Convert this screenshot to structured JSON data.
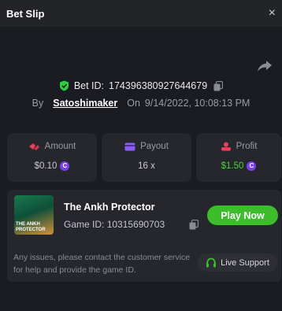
{
  "header": {
    "title": "Bet Slip",
    "close_glyph": "×"
  },
  "bet": {
    "id_label": "Bet ID:",
    "id_value": "174396380927644679",
    "by_label": "By",
    "username": "Satoshimaker",
    "on_label": "On",
    "datetime": "9/14/2022, 10:08:13 PM"
  },
  "stats": {
    "amount": {
      "label": "Amount",
      "value": "$0.10",
      "currency_glyph": "C"
    },
    "payout": {
      "label": "Payout",
      "value": "16 x"
    },
    "profit": {
      "label": "Profit",
      "value": "$1.50",
      "currency_glyph": "C"
    }
  },
  "game": {
    "title": "The Ankh Protector",
    "thumb_text": "THE ANKH PROTECTOR",
    "id_label": "Game ID:",
    "id_value": "10315690703",
    "play_label": "Play Now"
  },
  "footer": {
    "notice": "Any issues, please contact the customer service for help and provide the game ID.",
    "support_label": "Live Support"
  },
  "colors": {
    "background": "#1b1c21",
    "card": "#26272c",
    "play_green": "#3dbd2c",
    "profit_green": "#49d33a",
    "shield_green": "#2ecc40",
    "coin_purple": "#7b3ff2",
    "amount_icon": "#e8405a",
    "payout_icon": "#8a5cf6",
    "profit_icon": "#e8405a",
    "support_icon": "#3dbd2c"
  },
  "icons": {
    "close": "close-icon",
    "share": "share-icon",
    "verified": "shield-check-icon",
    "copy": "copy-icon",
    "amount": "bet-amount-icon",
    "payout": "payout-card-icon",
    "profit": "profit-icon",
    "coin": "coin-icon",
    "support": "headset-icon"
  }
}
